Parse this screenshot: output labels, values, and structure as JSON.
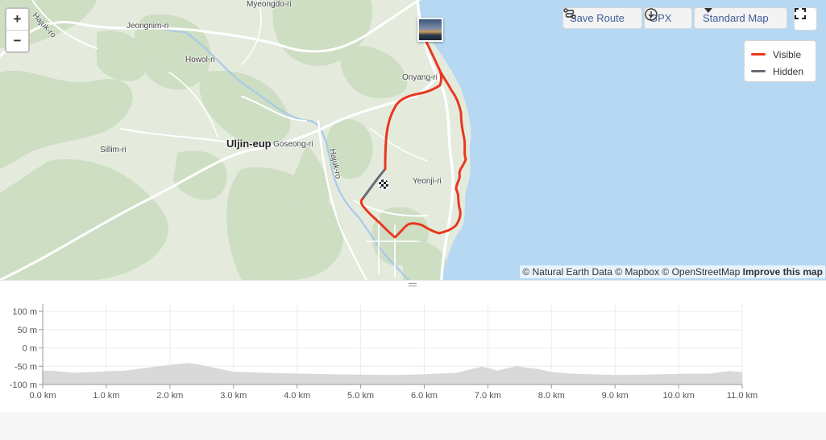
{
  "map": {
    "zoom_in": "+",
    "zoom_out": "−",
    "buttons": {
      "save_route": "Save Route",
      "gpx": "GPX",
      "map_style": "Standard Map"
    },
    "legend": {
      "visible_label": "Visible",
      "visible_color": "#e8381f",
      "hidden_label": "Hidden",
      "hidden_color": "#6b6b73"
    },
    "attribution": {
      "text": "© Natural Earth Data © Mapbox © OpenStreetMap",
      "improve": "Improve this map"
    },
    "labels": {
      "myeongdo": "Myeongdo-ri",
      "jeongnim": "Jeongnim-ri",
      "howol": "Howol-ri",
      "hajuk_nw": "Hajuk-ro",
      "onyang": "Onyang-ri",
      "uljin": "Uljin-eup",
      "goseong": "Goseong-ri",
      "hajuk_mid": "Hajuk-ro",
      "sillim": "Sillim-ri",
      "yeonji": "Yeonji-ri"
    }
  },
  "chart_data": {
    "type": "area",
    "ylabel": "",
    "xlabel": "",
    "yticks": [
      "100 m",
      "50 m",
      "0 m",
      "-50 m",
      "-100 m"
    ],
    "ytick_values": [
      100,
      50,
      0,
      -50,
      -100
    ],
    "xticks": [
      "0.0 km",
      "1.0 km",
      "2.0 km",
      "3.0 km",
      "4.0 km",
      "5.0 km",
      "6.0 km",
      "7.0 km",
      "8.0 km",
      "9.0 km",
      "10.0 km",
      "11.0 km"
    ],
    "xtick_values": [
      0,
      1,
      2,
      3,
      4,
      5,
      6,
      7,
      8,
      9,
      10,
      11
    ],
    "xlim": [
      0,
      11
    ],
    "ylim": [
      -100,
      120
    ],
    "grid": true,
    "fill_color": "#d9d9d9",
    "x": [
      0,
      0.2,
      0.5,
      1.0,
      1.3,
      1.7,
      2.0,
      2.3,
      2.5,
      2.8,
      3.0,
      3.5,
      4.0,
      4.5,
      5.0,
      5.5,
      6.0,
      6.5,
      6.7,
      6.9,
      7.0,
      7.15,
      7.3,
      7.45,
      7.6,
      7.8,
      8.0,
      8.3,
      8.6,
      9.0,
      9.5,
      10.0,
      10.5,
      10.8,
      11.0
    ],
    "y": [
      -62,
      -63,
      -68,
      -64,
      -62,
      -53,
      -46,
      -41,
      -47,
      -58,
      -65,
      -68,
      -70,
      -72,
      -73,
      -74,
      -72,
      -68,
      -60,
      -51,
      -55,
      -62,
      -56,
      -49,
      -54,
      -58,
      -66,
      -70,
      -72,
      -74,
      -73,
      -71,
      -70,
      -63,
      -66
    ]
  }
}
